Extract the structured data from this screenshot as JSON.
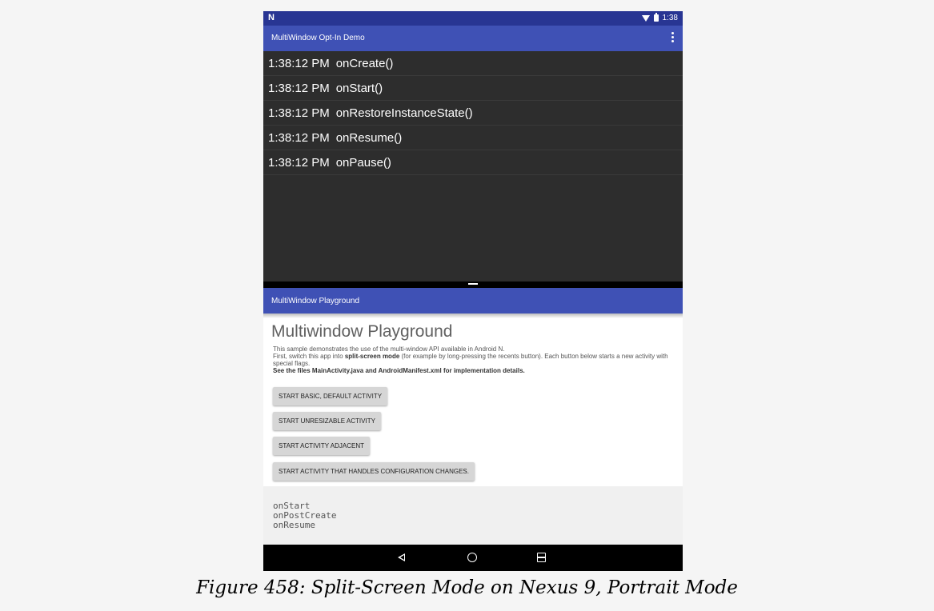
{
  "status_bar": {
    "logo": "N",
    "time": "1:38"
  },
  "top_app": {
    "title": "MultiWindow Opt-In Demo",
    "log_rows": [
      {
        "time": "1:38:12 PM",
        "event": "onCreate()"
      },
      {
        "time": "1:38:12 PM",
        "event": "onStart()"
      },
      {
        "time": "1:38:12 PM",
        "event": "onRestoreInstanceState()"
      },
      {
        "time": "1:38:12 PM",
        "event": "onResume()"
      },
      {
        "time": "1:38:12 PM",
        "event": "onPause()"
      }
    ]
  },
  "bottom_app": {
    "title": "MultiWindow Playground",
    "heading": "Multiwindow Playground",
    "desc_line1": "This sample demonstrates the use of the multi-window API available in Android N.",
    "desc_line2_pre": "First, switch this app into ",
    "desc_line2_bold": "split-screen mode",
    "desc_line2_post": " (for example by long-pressing the recents button). Each button below starts a new activity with special flags.",
    "desc_line3": "See the files MainActivity.java and AndroidManifest.xml for implementation details.",
    "buttons": {
      "basic": "START BASIC, DEFAULT ACTIVITY",
      "unresizable": "START UNRESIZABLE ACTIVITY",
      "adjacent": "START ACTIVITY ADJACENT",
      "config": "START ACTIVITY THAT HANDLES CONFIGURATION CHANGES."
    },
    "console_lines": [
      "onStart",
      "onPostCreate",
      "onResume"
    ]
  },
  "caption": "Figure 458: Split-Screen Mode on Nexus 9, Portrait Mode",
  "icons": [
    "wifi-icon",
    "battery-icon",
    "overflow-menu-icon",
    "back-icon",
    "home-icon",
    "recents-icon"
  ],
  "colors": {
    "primary": "#3f51b5",
    "primary_dark": "#283593",
    "log_bg": "#2d2d2d"
  }
}
